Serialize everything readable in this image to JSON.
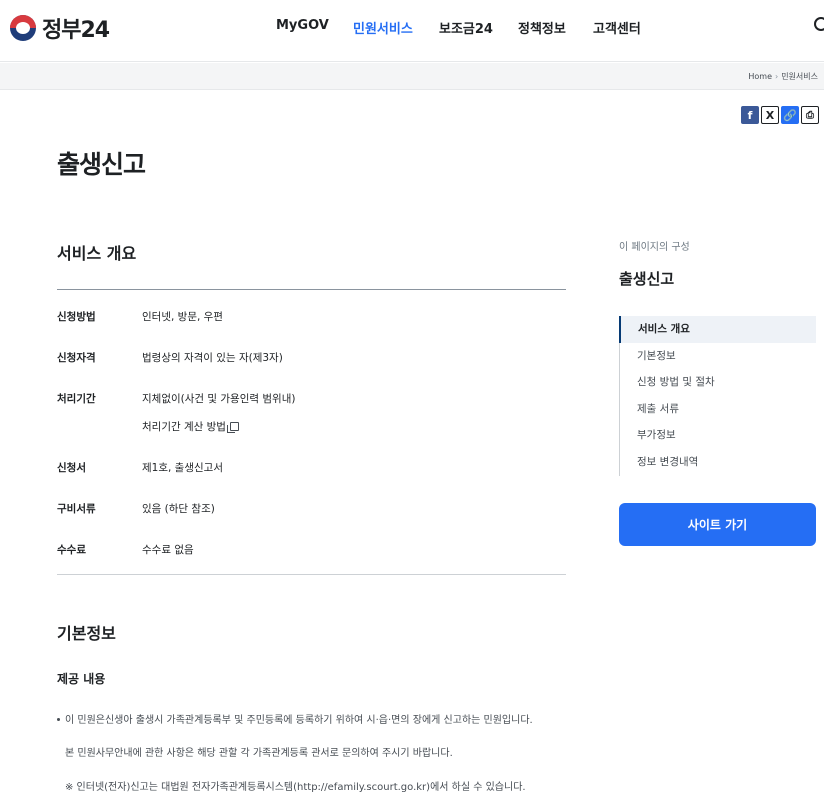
{
  "header": {
    "logo_text": "정부24",
    "nav": [
      "MyGOV",
      "민원서비스",
      "보조금24",
      "정책정보",
      "고객센터"
    ]
  },
  "breadcrumb": {
    "home": "Home",
    "current": "민원서비스"
  },
  "share": {
    "facebook": "f",
    "x": "X",
    "link": "🔗",
    "print": "⎙"
  },
  "page": {
    "title": "출생신고"
  },
  "overview": {
    "heading": "서비스 개요",
    "rows": [
      {
        "label": "신청방법",
        "value": "인터넷, 방문, 우편"
      },
      {
        "label": "신청자격",
        "value": "법령상의 자격이 있는 자(제3자)"
      },
      {
        "label": "처리기간",
        "value": "지체없이(사건 및 가용인력 범위내)",
        "extra": "처리기간 계산 방법"
      },
      {
        "label": "신청서",
        "value": "제1호, 출생신고서"
      },
      {
        "label": "구비서류",
        "value": "있음 (하단 참조)"
      },
      {
        "label": "수수료",
        "value": "수수료 없음"
      }
    ]
  },
  "basic_info": {
    "heading": "기본정보",
    "subheading": "제공 내용",
    "paragraphs": [
      "이 민원은신생아 출생시 가족관계등록부 및 주민등록에 등록하기 위하여 시·읍·면의 장에게 신고하는 민원입니다.",
      "본 민원사무안내에 관한 사항은 해당 관할 각 가족관계등록 관서로 문의하여 주시기 바랍니다.",
      "※ 인터넷(전자)신고는 대법원 전자가족관계등록시스템(http://efamily.scourt.go.kr)에서 하실 수 있습니다."
    ]
  },
  "toc": {
    "caption": "이 페이지의 구성",
    "title": "출생신고",
    "items": [
      "서비스 개요",
      "기본정보",
      "신청 방법 및 절차",
      "제출 서류",
      "부가정보",
      "정보 변경내역"
    ]
  },
  "site_button": "사이트 가기"
}
